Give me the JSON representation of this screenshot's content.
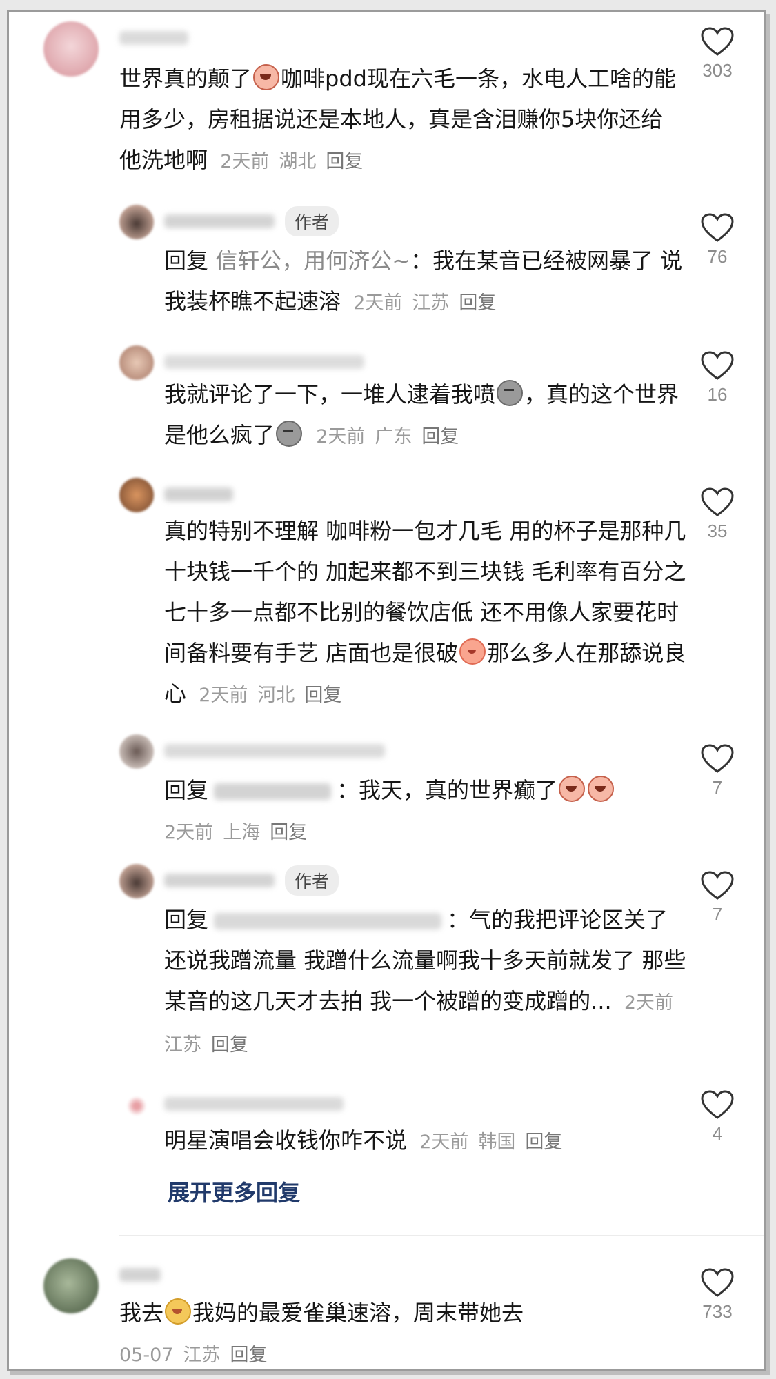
{
  "colors": {
    "text": "#161616",
    "meta": "#9a9a9a",
    "expand_link": "#213a6b",
    "badge_bg": "#ededed"
  },
  "icons": {
    "like": "heart-outline-icon"
  },
  "comments": [
    {
      "text": "世界真的颠了",
      "emoji": "crying-emoji",
      "text2": "咖啡pdd现在六毛一条，水电人工啥的能用多少，房租据说还是本地人，真是含泪赚你5块你还给他洗地啊",
      "time": "2天前",
      "location": "湖北",
      "reply": "回复",
      "likes": "303"
    }
  ],
  "replies": [
    {
      "badge": "作者",
      "lead": "回复",
      "target": "信轩公，用何济公~",
      "text": "：我在某音已经被网暴了 说我装杯瞧不起速溶",
      "time": "2天前",
      "location": "江苏",
      "reply": "回复",
      "likes": "76"
    },
    {
      "text_a": "我就评论了一下，一堆人逮着我喷",
      "text_b": "，真的这个世界是他么疯了",
      "time": "2天前",
      "location": "广东",
      "reply": "回复",
      "likes": "16"
    },
    {
      "text_a": "真的特别不理解 咖啡粉一包才几毛 用的杯子是那种几十块钱一千个的 加起来都不到三块钱 毛利率有百分之七十多一点都不比别的餐饮店低 还不用像人家要花时间备料要有手艺 店面也是很破",
      "text_b": "那么多人在那舔说良心",
      "time": "2天前",
      "location": "河北",
      "reply": "回复",
      "likes": "35"
    },
    {
      "lead": "回复",
      "text": "：我天，真的世界癫了",
      "time": "2天前",
      "location": "上海",
      "reply": "回复",
      "likes": "7"
    },
    {
      "badge": "作者",
      "lead": "回复",
      "text": "：气的我把评论区关了 还说我蹭流量 我蹭什么流量啊我十多天前就发了 那些某音的这几天才去拍 我一个被蹭的变成蹭的...",
      "time": "2天前",
      "location": "江苏",
      "reply": "回复",
      "likes": "7"
    },
    {
      "text": "明星演唱会收钱你咋不说",
      "time": "2天前",
      "location": "韩国",
      "reply": "回复",
      "likes": "4"
    }
  ],
  "expand_more": "展开更多回复",
  "last_comment": {
    "text_a": "我去",
    "text_b": "我妈的最爱雀巢速溶，周末带她去",
    "time": "05-07",
    "location": "江苏",
    "reply": "回复",
    "likes": "733"
  }
}
